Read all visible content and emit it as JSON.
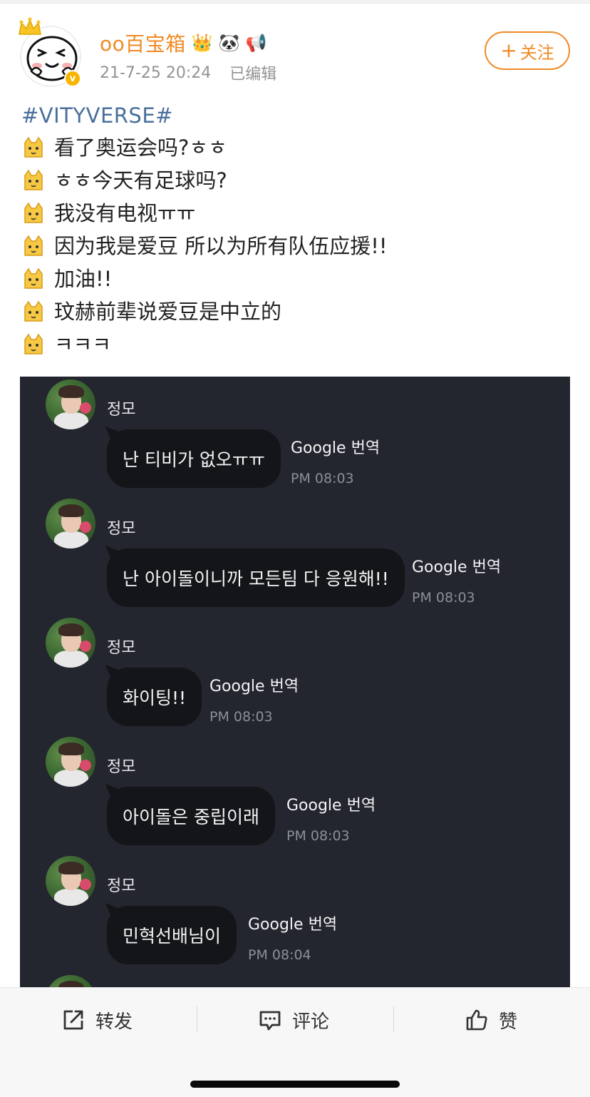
{
  "header": {
    "username": "oo百宝箱",
    "badges": [
      "👑",
      "🐼",
      "📢"
    ],
    "timestamp": "21-7-25 20:24",
    "edited_label": "已编辑",
    "follow_label": "关注"
  },
  "post": {
    "hashtag": "#VITYVERSE#",
    "lines": [
      "看了奥运会吗?ㅎㅎ",
      "ㅎㅎ今天有足球吗?",
      "我没有电视ㅠㅠ",
      "因为我是爱豆 所以为所有队伍应援!!",
      "加油!!",
      "玟赫前辈说爱豆是中立的",
      "ㅋㅋㅋ"
    ]
  },
  "chat": {
    "messages": [
      {
        "sender": "정모",
        "text": "난 티비가 없오ㅠㅠ",
        "translate": "Google 번역",
        "time": "PM 08:03"
      },
      {
        "sender": "정모",
        "text": "난 아이돌이니까 모든팀 다 응원해!!",
        "translate": "Google 번역",
        "time": "PM 08:03"
      },
      {
        "sender": "정모",
        "text": "화이팅!!",
        "translate": "Google 번역",
        "time": "PM 08:03"
      },
      {
        "sender": "정모",
        "text": "아이돌은 중립이래",
        "translate": "Google 번역",
        "time": "PM 08:03"
      },
      {
        "sender": "정모",
        "text": "민혁선배님이",
        "translate": "Google 번역",
        "time": "PM 08:04"
      }
    ]
  },
  "actions": {
    "repost": "转发",
    "comment": "评论",
    "like": "赞"
  },
  "icons": [
    "crown-icon",
    "verified-icon",
    "plus-icon",
    "cat-emoji-icon",
    "repost-icon",
    "comment-icon",
    "like-icon"
  ],
  "colors": {
    "brand_orange": "#f08a24",
    "hashtag_blue": "#4a6f9c",
    "chat_bg": "#23252f",
    "bubble_bg": "#141519",
    "verified_gold": "#f7b500"
  }
}
